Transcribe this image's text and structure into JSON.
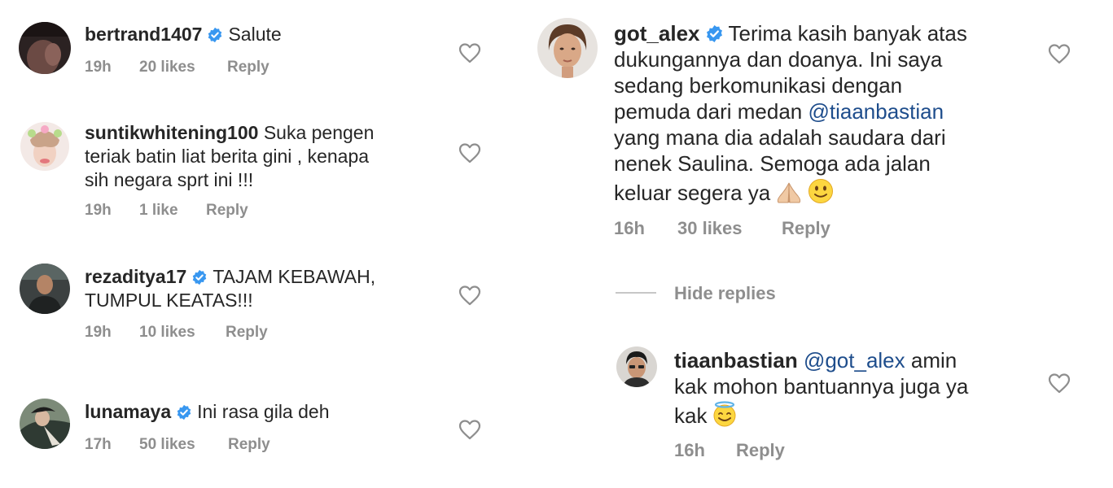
{
  "comments": [
    {
      "username": "bertrand1407",
      "verified": true,
      "lines": [
        "Salute"
      ],
      "time": "19h",
      "likes": "20 likes",
      "reply": "Reply"
    },
    {
      "username": "suntikwhitening100",
      "verified": false,
      "lines": [
        "Suka pengen",
        "teriak batin liat berita gini , kenapa",
        "sih negara sprt ini !!!"
      ],
      "time": "19h",
      "likes": "1 like",
      "reply": "Reply"
    },
    {
      "username": "rezaditya17",
      "verified": true,
      "lines": [
        "TAJAM KEBAWAH,",
        "TUMPUL KEATAS!!!"
      ],
      "time": "19h",
      "likes": "10 likes",
      "reply": "Reply"
    },
    {
      "username": "lunamaya",
      "verified": true,
      "lines": [
        "Ini rasa gila deh"
      ],
      "time": "17h",
      "likes": "50 likes",
      "reply": "Reply"
    }
  ],
  "main_comment": {
    "username": "got_alex",
    "verified": true,
    "line1": "Terima kasih banyak atas",
    "line2": "dukungannya dan doanya. Ini saya",
    "line3": "sedang berkomunikasi dengan",
    "line4_before": "pemuda dari medan ",
    "line4_mention": "@tiaanbastian",
    "line5": "yang mana dia adalah saudara dari",
    "line6": "nenek Saulina. Semoga ada jalan",
    "line7": "keluar segera ya",
    "emojis": [
      "folded-hands-icon",
      "slightly-smiling-face-icon"
    ],
    "time": "16h",
    "likes": "30 likes",
    "reply": "Reply"
  },
  "hide_replies": "Hide replies",
  "reply_comment": {
    "username": "tiaanbastian",
    "verified": false,
    "mention": "@got_alex",
    "line1_rest": " amin",
    "line2": "kak mohon bantuannya juga ya",
    "line3": "kak",
    "emoji": "smiling-face-with-halo-icon",
    "time": "16h",
    "reply": "Reply"
  },
  "colors": {
    "text": "#262626",
    "meta": "#8e8e8e",
    "mention": "#1e4d8c",
    "verified": "#3897f0",
    "heart": "#8e8e8e",
    "divider": "#c7c7c7"
  }
}
